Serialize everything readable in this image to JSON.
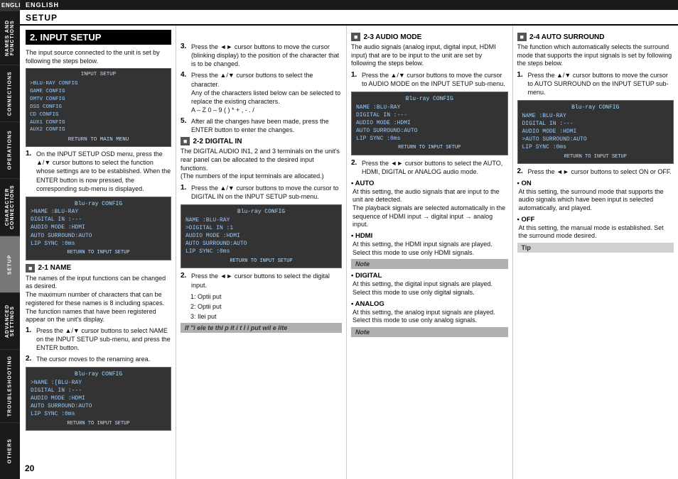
{
  "sidebar": {
    "top_label": "ENGLISH",
    "sections": [
      {
        "label": "NAMES AND FUNCTIONS",
        "active": false
      },
      {
        "label": "CONNECTIONS",
        "active": false
      },
      {
        "label": "OPERATIONS",
        "active": false
      },
      {
        "label": "CHARACTER CONNECTIONS",
        "active": false
      },
      {
        "label": "SETUP",
        "active": true
      },
      {
        "label": "ADVANCED SETTINGS",
        "active": false
      },
      {
        "label": "TROUBLESHOOTING",
        "active": false
      },
      {
        "label": "OTHERS",
        "active": false
      }
    ]
  },
  "setup_header": "SETUP",
  "main_heading": "2. INPUT SETUP",
  "page_number": "20",
  "intro_text": "The input source connected to the unit is set by following the steps below.",
  "input_setup_table": {
    "title": "INPUT SETUP",
    "rows": [
      ">BLU-RAY   CONFIG",
      "GAME       CONFIG",
      "DMTV       CONFIG",
      "DSS        CONFIG",
      "CD         CONFIG",
      "AUX1       CONFIG",
      "AUX2       CONFIG"
    ],
    "footer": "RETURN TO MAIN MENU"
  },
  "steps_left": [
    {
      "num": "1.",
      "text": "On the INPUT SETUP OSD menu, press the ▲/▼ cursor buttons to select the function whose settings are to be established. When the ENTER button is now pressed, the corresponding sub-menu is displayed."
    }
  ],
  "screen1": {
    "title": "Blu-ray CONFIG",
    "rows": [
      ">NAME        :BLU-RAY",
      "DIGITAL IN  :---",
      "AUDIO MODE  :HDMI",
      "AUTO SURROUND:AUTO",
      "LIP SYNC    :0ms"
    ],
    "footer": "RETURN TO INPUT SETUP"
  },
  "section_2_1": {
    "title": "2-1 NAME",
    "text": "The names of the input functions can be changed as desired.\nThe maximum number of characters that can be registered for these names is 8 including spaces.\nThe function names that have been registered appear on the unit's display.",
    "steps": [
      {
        "num": "1.",
        "text": "Press the ▲/▼ cursor buttons to select NAME on the INPUT SETUP sub-menu, and press the ENTER button."
      },
      {
        "num": "2.",
        "text": "The cursor moves to the renaming area."
      }
    ],
    "screen": {
      "title": "Blu-ray CONFIG",
      "rows": [
        ">NAME      :[BLU-RAY",
        "DIGITAL IN :---",
        "AUDIO MODE  :HDMI",
        "AUTO SURROUND:AUTO",
        "LIP SYNC    :0ms"
      ],
      "footer": "RETURN TO INPUT SETUP"
    }
  },
  "steps_middle": [
    {
      "num": "3.",
      "text": "Press the ◄► cursor buttons to move the cursor (blinking display) to the position of the character that is to be changed."
    },
    {
      "num": "4.",
      "text": "Press the ▲/▼ cursor buttons to select the character.\nAny of the characters listed below can be selected to replace the existing characters.\nA – Z 0 – 9 ( ) * + , - . /"
    },
    {
      "num": "5.",
      "text": "After all the changes have been made, press the ENTER button to enter the changes."
    }
  ],
  "section_2_2": {
    "title": "2-2 DIGITAL IN",
    "description": "The DIGITAL AUDIO IN1, 2 and 3 terminals on the unit's rear panel can be allocated to the desired input functions.\n(The numbers of the input terminals are allocated.)",
    "steps": [
      {
        "num": "1.",
        "text": "Press the ▲/▼ cursor buttons to move the cursor to DIGITAL IN on the INPUT SETUP sub-menu."
      }
    ],
    "screen": {
      "title": "Blu-ray CONFIG",
      "rows": [
        "NAME       :BLU-RAY",
        ">DIGITAL IN  :1",
        "AUDIO MODE  :HDMI",
        "AUTO SURROUND:AUTO",
        "LIP SYNC    :0ms"
      ],
      "footer": "RETURN TO INPUT SETUP"
    },
    "steps2": [
      {
        "num": "2.",
        "text": "Press the ◄► cursor buttons to select the digital input."
      }
    ],
    "digital_inputs": [
      "1: Optii   put",
      "2: Optii   put",
      "3:   Ilei    put"
    ],
    "note": "If \"i   ele te  thi p it   i t I\ni put wil e  lite"
  },
  "section_2_3": {
    "title": "2-3 AUDIO MODE",
    "description": "The audio signals (analog input, digital input, HDMI input) that are to be input to the unit are set by following the steps below.",
    "steps": [
      {
        "num": "1.",
        "text": "Press the ▲/▼ cursor buttons to move the cursor to AUDIO MODE on the INPUT SETUP sub-menu."
      }
    ],
    "screen": {
      "title": "Blu-ray CONFIG",
      "rows": [
        "NAME        :BLU-RAY",
        "DIGITAL IN  :---",
        "AUDIO MODE  :HDMI",
        "AUTO SURROUND:AUTO",
        "LIP SYNC    :0ms"
      ],
      "footer": "RETURN TO INPUT SETUP"
    },
    "steps2": [
      {
        "num": "2.",
        "text": "Press the ◄► cursor buttons to select the AUTO, HDMI, DIGITAL or ANALOG audio mode."
      }
    ],
    "bullets": [
      {
        "label": "• AUTO",
        "text": "At this setting, the audio signals that are input to the unit are detected.\nThe playback signals are selected automatically in the sequence of HDMI input → digital input → analog input."
      },
      {
        "label": "• HDMI",
        "text": "At this setting, the HDMI input signals are played.\nSelect this mode to use only HDMI signals."
      }
    ],
    "note": "Note",
    "bullets2": [
      {
        "label": "• DIGITAL",
        "text": "At this setting, the digital input signals are played.\nSelect this mode to use only digital signals."
      },
      {
        "label": "• ANALOG",
        "text": "At this setting, the analog input signals are played.\nSelect this mode to use only analog signals."
      }
    ],
    "note2": "Note"
  },
  "section_2_4": {
    "title": "2-4 AUTO SURROUND",
    "description": "The function which automatically selects the surround mode that supports the input signals is set by following the steps below.",
    "steps": [
      {
        "num": "1.",
        "text": "Press the ▲/▼ cursor buttons to move the cursor to AUTO SURROUND on the INPUT SETUP sub-menu."
      }
    ],
    "screen": {
      "title": "Blu-ray CONFIG",
      "rows": [
        "NAME        :BLU-RAY",
        "DIGITAL IN  :---",
        "AUDIO MODE  :HDMI",
        ">AUTO SURROUND:AUTO",
        "LIP SYNC    :0ms"
      ],
      "footer": "RETURN TO INPUT SETUP"
    },
    "steps2": [
      {
        "num": "2.",
        "text": "Press the ◄► cursor buttons to select ON or OFF."
      }
    ],
    "bullets": [
      {
        "label": "• ON",
        "text": "At this setting, the surround mode that supports the audio signals which have been input is selected automatically, and played."
      },
      {
        "label": "• OFF",
        "text": "At this setting, the manual mode is established. Set the surround mode desired."
      }
    ],
    "tip": "Tip"
  }
}
